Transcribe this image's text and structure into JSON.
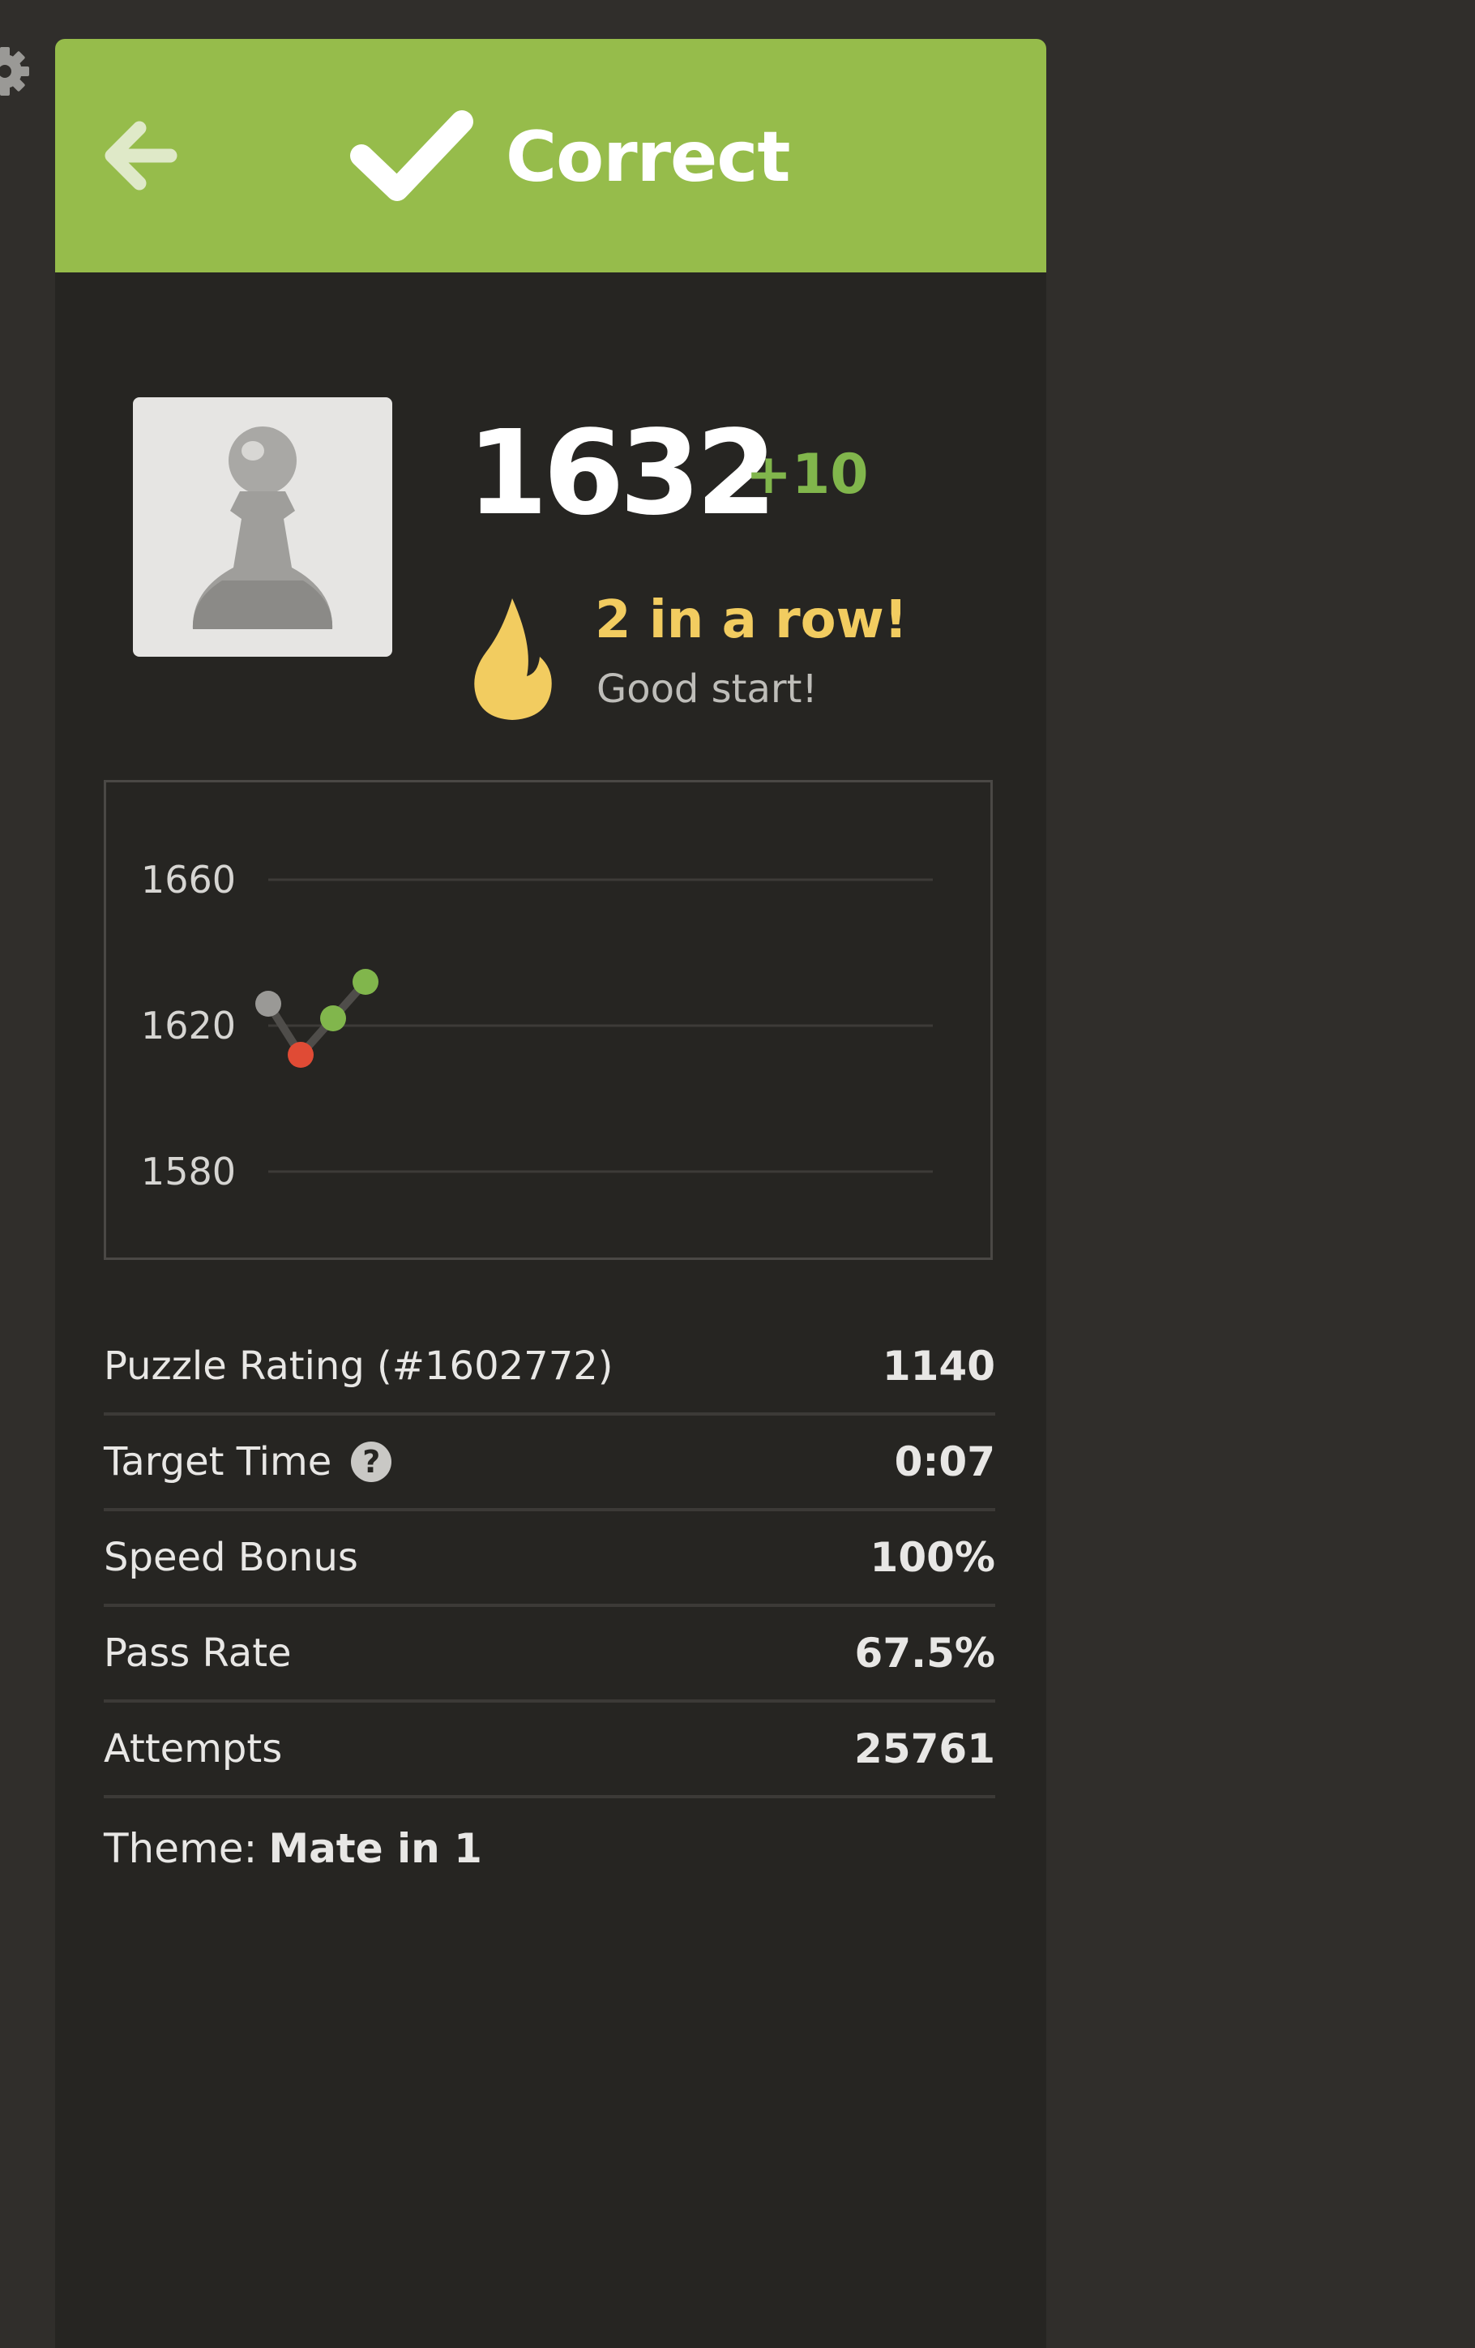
{
  "header": {
    "title": "Correct",
    "color": "#96bc4b"
  },
  "player": {
    "avatar": "pawn-icon",
    "rating": "1632",
    "rating_change": "+10",
    "streak": "2 in a row!",
    "streak_message": "Good start!",
    "streak_icon": "flame-icon"
  },
  "chart_data": {
    "type": "line",
    "y_ticks": [
      "1660",
      "1620",
      "1580"
    ],
    "ylim": [
      1580,
      1660
    ],
    "x": [
      1,
      2,
      3,
      4
    ],
    "values": [
      1626,
      1612,
      1622,
      1632
    ],
    "point_colors": [
      "#9a9996",
      "#e04b35",
      "#81b64c",
      "#81b64c"
    ],
    "grid": true
  },
  "stats": [
    {
      "label": "Puzzle Rating (#1602772)",
      "value": "1140"
    },
    {
      "label": "Target Time",
      "value": "0:07",
      "help_icon": "question-icon"
    },
    {
      "label": "Speed Bonus",
      "value": "100%"
    },
    {
      "label": "Pass Rate",
      "value": "67.5%"
    },
    {
      "label": "Attempts",
      "value": "25761"
    }
  ],
  "theme": {
    "label": "Theme:",
    "value": "Mate in 1"
  }
}
